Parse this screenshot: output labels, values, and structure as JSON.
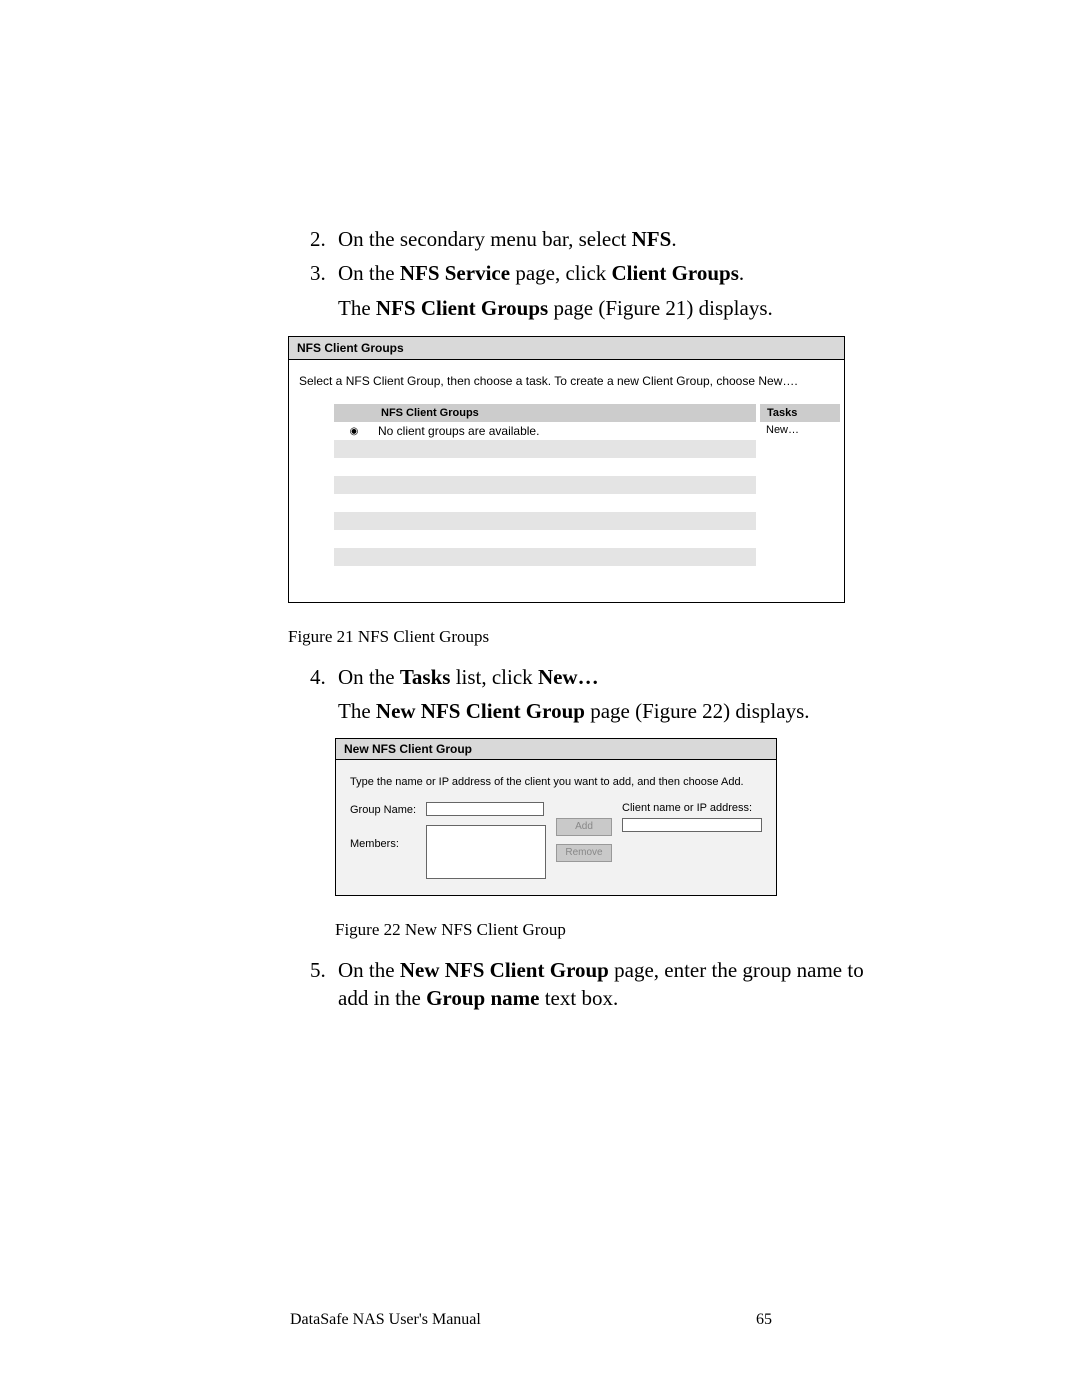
{
  "steps": {
    "s2": {
      "num": "2.",
      "text_a": "On the secondary menu bar, select ",
      "text_b": "NFS",
      "text_c": "."
    },
    "s3": {
      "num": "3.",
      "text_a": "On the ",
      "text_b": "NFS Service",
      "text_c": " page, click ",
      "text_d": "Client Groups",
      "text_e": ".",
      "follow_a": "The ",
      "follow_b": "NFS Client Groups",
      "follow_c": " page (Figure 21) dis­plays."
    },
    "s4": {
      "num": "4.",
      "text_a": "On the ",
      "text_b": "Tasks",
      "text_c": " list, click ",
      "text_d": "New…",
      "follow_a": "The ",
      "follow_b": "New NFS Client Group",
      "follow_c": " page (Figure 22) displays."
    },
    "s5": {
      "num": "5.",
      "text_a": "On the ",
      "text_b": "New NFS Client Group",
      "text_c": " page, enter the group name to add in the ",
      "text_d": "Group name",
      "text_e": " text box."
    }
  },
  "fig21": {
    "title": "NFS Client Groups",
    "desc": "Select a NFS Client Group, then choose a task. To create a new Client Group, choose New….",
    "col_left_header": "NFS Client Groups",
    "col_right_header": "Tasks",
    "row_radio": "◉",
    "row_text": "No client groups are available.",
    "task_new": "New…"
  },
  "caption21": "Figure 21   NFS Client Groups",
  "fig22": {
    "title": "New NFS Client Group",
    "desc": "Type the name or IP address of the client you want to add, and then choose Add.",
    "label_group": "Group Name:",
    "label_members": "Members:",
    "btn_add": "Add",
    "btn_remove": "Remove",
    "label_client": "Client name or IP address:"
  },
  "caption22": "Figure 22   New NFS Client Group",
  "footer": {
    "left": "DataSafe NAS User's Manual",
    "right": "65"
  }
}
